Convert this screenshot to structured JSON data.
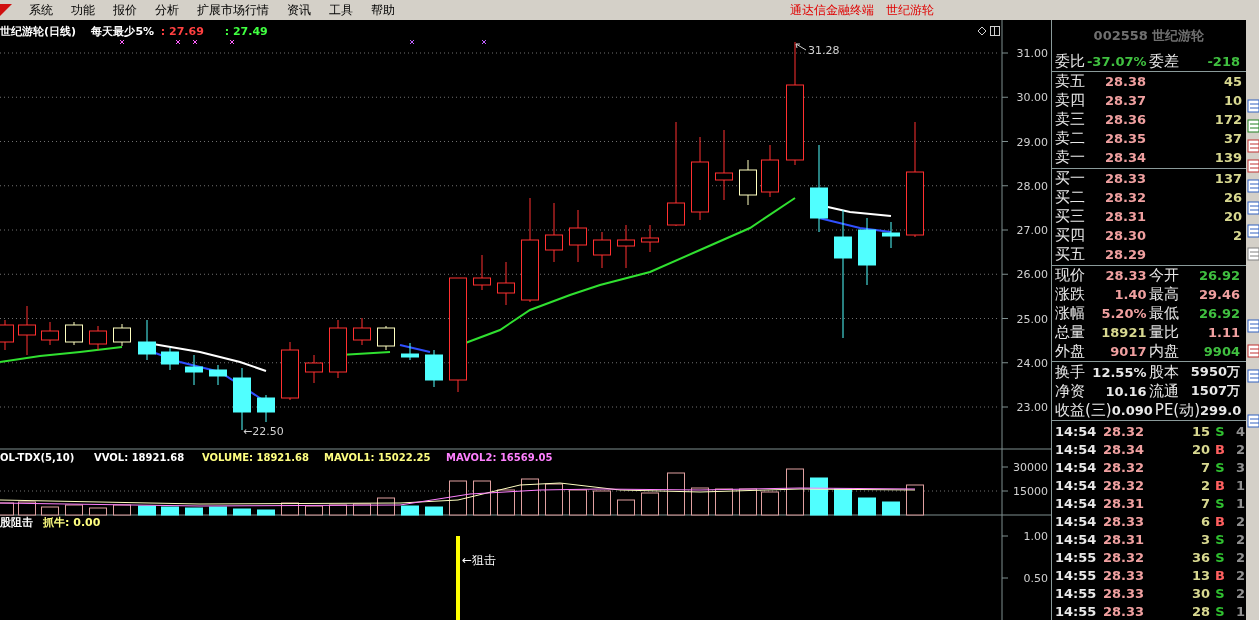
{
  "menu": {
    "items": [
      {
        "label": "系统"
      },
      {
        "label": "功能"
      },
      {
        "label": "报价"
      },
      {
        "label": "分析"
      },
      {
        "label": "扩展市场行情"
      },
      {
        "label": "资讯"
      },
      {
        "label": "工具"
      },
      {
        "label": "帮助"
      }
    ],
    "titles": [
      "通达信金融终端",
      "世纪游轮"
    ]
  },
  "price_chart": {
    "legend": [
      {
        "text": "世纪游轮(日线)",
        "color": "#ffffff"
      },
      {
        "text": "每天最少5%",
        "color": "#ffffff"
      },
      {
        "text": ": 27.69",
        "color": "#ff4040"
      },
      {
        "text": ": 27.49",
        "color": "#40ff40"
      }
    ],
    "axis": [
      "31.00",
      "30.00",
      "29.00",
      "28.00",
      "27.00",
      "26.00",
      "25.00",
      "24.00",
      "23.00"
    ],
    "high_label": "31.28",
    "low_label": "←22.50"
  },
  "volume_chart": {
    "legend": [
      {
        "text": "OL-TDX(5,10)",
        "color": "#ffffff"
      },
      {
        "text": "VVOL: 18921.68",
        "color": "#ffffff"
      },
      {
        "text": "VOLUME: 18921.68",
        "color": "#ffff80"
      },
      {
        "text": "MAVOL1: 15022.25",
        "color": "#ffff80"
      },
      {
        "text": "MAVOL2: 16569.05",
        "color": "#ff80ff"
      }
    ],
    "axis": [
      "30000",
      "15000"
    ]
  },
  "indicator_chart": {
    "legend": [
      {
        "text": "股阻击",
        "color": "#ffffff"
      },
      {
        "text": "抓牛: 0.00",
        "color": "#ffff80"
      }
    ],
    "axis": [
      "1.00",
      "0.50"
    ],
    "signal_label": "←狙击"
  },
  "quote": {
    "title": "002558 世纪游轮",
    "ratio": [
      {
        "label": "委比",
        "value": "-37.07%",
        "color": "#40c040"
      },
      {
        "label": "委差",
        "value": "-218",
        "color": "#40c040"
      }
    ],
    "sell_orders": [
      {
        "label": "卖五",
        "price": "28.38",
        "volume": "45"
      },
      {
        "label": "卖四",
        "price": "28.37",
        "volume": "10"
      },
      {
        "label": "卖三",
        "price": "28.36",
        "volume": "172"
      },
      {
        "label": "卖二",
        "price": "28.35",
        "volume": "37"
      },
      {
        "label": "卖一",
        "price": "28.34",
        "volume": "139"
      }
    ],
    "buy_orders": [
      {
        "label": "买一",
        "price": "28.33",
        "volume": "137"
      },
      {
        "label": "买二",
        "price": "28.32",
        "volume": "26"
      },
      {
        "label": "买三",
        "price": "28.31",
        "volume": "20"
      },
      {
        "label": "买四",
        "price": "28.30",
        "volume": "2"
      },
      {
        "label": "买五",
        "price": "28.29"
      }
    ],
    "quotes": [
      [
        {
          "label": "现价",
          "value": "28.33",
          "color": "#f0a0a0"
        },
        {
          "label": "今开",
          "value": "26.92",
          "color": "#40c040"
        }
      ],
      [
        {
          "label": "涨跌",
          "value": "1.40",
          "color": "#f0a0a0"
        },
        {
          "label": "最高",
          "value": "29.46",
          "color": "#f0a0a0"
        }
      ],
      [
        {
          "label": "涨幅",
          "value": "5.20%",
          "color": "#f0a0a0"
        },
        {
          "label": "最低",
          "value": "26.92",
          "color": "#40c040"
        }
      ],
      [
        {
          "label": "总量",
          "value": "18921",
          "color": "#d8d890"
        },
        {
          "label": "量比",
          "value": "1.11",
          "color": "#f0a0a0"
        }
      ],
      [
        {
          "label": "外盘",
          "value": "9017",
          "color": "#f0a0a0"
        },
        {
          "label": "内盘",
          "value": "9904",
          "color": "#40c040"
        }
      ]
    ],
    "stats": [
      [
        {
          "label": "换手",
          "value": "12.55%"
        },
        {
          "label": "股本",
          "value": "5950万"
        }
      ],
      [
        {
          "label": "净资",
          "value": "10.16"
        },
        {
          "label": "流通",
          "value": "1507万"
        }
      ],
      [
        {
          "label": "收益(三)",
          "value": "0.090"
        },
        {
          "label": "PE(动)",
          "value": "299.0"
        }
      ]
    ],
    "ticks": [
      {
        "time": "14:54",
        "price": "28.32",
        "volume": "15",
        "side": "S",
        "kind": "sell",
        "count": "4"
      },
      {
        "time": "14:54",
        "price": "28.34",
        "volume": "20",
        "side": "B",
        "kind": "buy",
        "count": "2"
      },
      {
        "time": "14:54",
        "price": "28.32",
        "volume": "7",
        "side": "S",
        "kind": "sell",
        "count": "3"
      },
      {
        "time": "14:54",
        "price": "28.32",
        "volume": "2",
        "side": "B",
        "kind": "buy",
        "count": "1"
      },
      {
        "time": "14:54",
        "price": "28.31",
        "volume": "7",
        "side": "S",
        "kind": "sell",
        "count": "1"
      },
      {
        "time": "14:54",
        "price": "28.33",
        "volume": "6",
        "side": "B",
        "kind": "buy",
        "count": "2"
      },
      {
        "time": "14:54",
        "price": "28.31",
        "volume": "3",
        "side": "S",
        "kind": "sell",
        "count": "2"
      },
      {
        "time": "14:55",
        "price": "28.32",
        "volume": "36",
        "side": "S",
        "kind": "sell",
        "count": "2"
      },
      {
        "time": "14:55",
        "price": "28.33",
        "volume": "13",
        "side": "B",
        "kind": "buy",
        "count": "2"
      },
      {
        "time": "14:55",
        "price": "28.33",
        "volume": "30",
        "side": "S",
        "kind": "sell",
        "count": "2"
      },
      {
        "time": "14:55",
        "price": "28.33",
        "volume": "28",
        "side": "S",
        "kind": "sell",
        "count": "1"
      }
    ]
  }
}
